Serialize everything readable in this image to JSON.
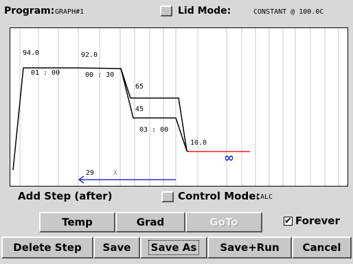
{
  "header": {
    "program_label": "Program:",
    "program_name": "GRAPH#1",
    "lid_mode_label": "Lid Mode:",
    "lid_mode_value": "CONSTANT @ 100.0C"
  },
  "graph": {
    "labels": {
      "step1_temp": "94.0",
      "step1_time": "01 : 00",
      "step2_temp": "92.0",
      "step2_time": "00 : 30",
      "step3_temp_high": "65",
      "step3_temp_low": "45",
      "step3_time": "03 : 00",
      "step4_temp": "10.0",
      "step4_time": "∞",
      "goto_count": "29",
      "goto_x": "X"
    },
    "colors": {
      "line": "#000000",
      "hold": "#e02020",
      "goto": "#2030d0",
      "infinity": "#2030d0",
      "grid": "#c8c8c8"
    }
  },
  "mid": {
    "add_step_label": "Add Step (after)",
    "control_mode_label": "Control Mode:",
    "control_mode_value": "CALC"
  },
  "row1": {
    "temp": "Temp",
    "grad": "Grad",
    "goto": "GoTo",
    "forever_label": "Forever",
    "forever_checked": "✔"
  },
  "row2": {
    "delete_step": "Delete Step",
    "save": "Save",
    "save_as": "Save As",
    "save_run": "Save+Run",
    "cancel": "Cancel"
  }
}
